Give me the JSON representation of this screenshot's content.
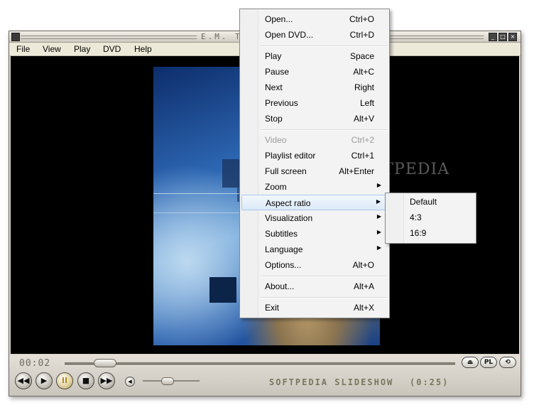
{
  "window": {
    "title": "E.M. TOTEM",
    "buttons": [
      "_",
      "□",
      "×"
    ]
  },
  "menubar": [
    "File",
    "View",
    "Play",
    "DVD",
    "Help"
  ],
  "player": {
    "elapsed": "00:02",
    "track_title": "SOFTPEDIA SLIDESHOW",
    "duration": "(0:25)",
    "pill_buttons": [
      "⏏",
      "PL",
      "⟲"
    ],
    "transport": [
      "◀◀",
      "▶",
      "II",
      "■",
      "▶▶"
    ],
    "volume_icon": "◀"
  },
  "watermark": "SOFTPEDIA",
  "context_menu": [
    {
      "label": "Open...",
      "shortcut": "Ctrl+O"
    },
    {
      "label": "Open DVD...",
      "shortcut": "Ctrl+D"
    },
    {
      "label": "Play",
      "shortcut": "Space"
    },
    {
      "label": "Pause",
      "shortcut": "Alt+C"
    },
    {
      "label": "Next",
      "shortcut": "Right"
    },
    {
      "label": "Previous",
      "shortcut": "Left"
    },
    {
      "label": "Stop",
      "shortcut": "Alt+V"
    },
    {
      "label": "Video",
      "shortcut": "Ctrl+2",
      "disabled": true
    },
    {
      "label": "Playlist editor",
      "shortcut": "Ctrl+1"
    },
    {
      "label": "Full screen",
      "shortcut": "Alt+Enter"
    },
    {
      "label": "Zoom",
      "submenu": true
    },
    {
      "label": "Aspect ratio",
      "submenu": true,
      "highlighted": true
    },
    {
      "label": "Visualization",
      "submenu": true
    },
    {
      "label": "Subtitles",
      "submenu": true
    },
    {
      "label": "Language",
      "submenu": true
    },
    {
      "label": "Options...",
      "shortcut": "Alt+O"
    },
    {
      "label": "About...",
      "shortcut": "Alt+A"
    },
    {
      "label": "Exit",
      "shortcut": "Alt+X"
    }
  ],
  "aspect_submenu": [
    "Default",
    "4:3",
    "16:9"
  ]
}
